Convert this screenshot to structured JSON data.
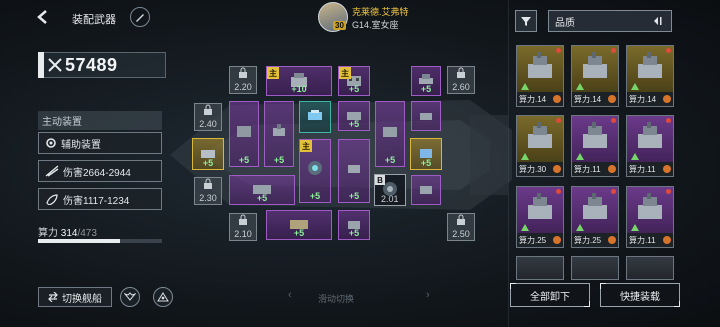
{
  "header": {
    "title": "装配武器",
    "pilot": {
      "name": "克莱德.艾弗特",
      "sector": "G14.室女座",
      "level": "30"
    }
  },
  "power": {
    "value": "57489"
  },
  "active_section": {
    "label": "主动装置",
    "aux_label": "辅助装置",
    "damage_1": "伤害2664-2944",
    "damage_2": "伤害1117-1234"
  },
  "compute": {
    "label": "算力",
    "used": "314",
    "max": "/473",
    "fill_fraction": 0.664
  },
  "bottom": {
    "switch_ship": "切换舰船",
    "swipe_hint": "滑动切换"
  },
  "slots": {
    "locks": [
      "2.20",
      "2.60",
      "2.40",
      "2.30",
      "2.10",
      "2.50"
    ],
    "plus_10": "+10",
    "plus_5": "+5",
    "main_tag": "主",
    "b_tag": "B",
    "b_slot_value": "2.01"
  },
  "right": {
    "sort_label": "品质",
    "cards": [
      {
        "compute": "算力.14",
        "quality": "gold"
      },
      {
        "compute": "算力.14",
        "quality": "gold"
      },
      {
        "compute": "算力.14",
        "quality": "gold"
      },
      {
        "compute": "算力.30",
        "quality": "gold"
      },
      {
        "compute": "算力.11",
        "quality": "purple"
      },
      {
        "compute": "算力.11",
        "quality": "purple"
      },
      {
        "compute": "算力.25",
        "quality": "purple"
      },
      {
        "compute": "算力.25",
        "quality": "purple"
      },
      {
        "compute": "算力.11",
        "quality": "purple"
      }
    ],
    "unequip_all": "全部卸下",
    "quick_equip": "快捷装载"
  },
  "colors": {
    "gold": "#d8b73b",
    "purple": "#9f5cc4",
    "plus_green": "#8ef09a",
    "pilot_name": "#f0c541"
  }
}
